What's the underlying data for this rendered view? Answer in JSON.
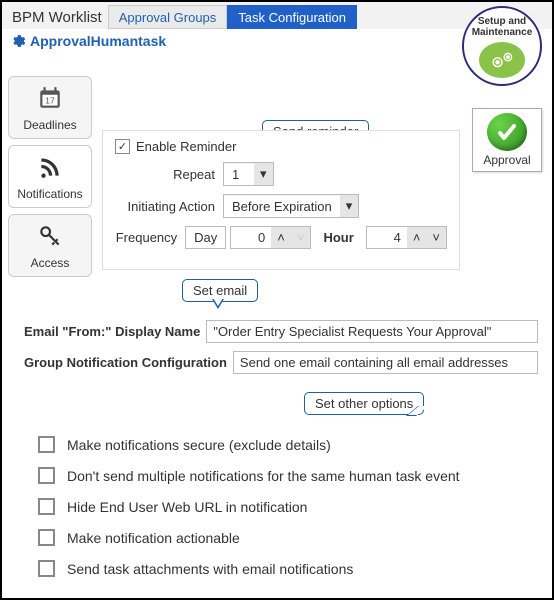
{
  "topbar": {
    "title": "BPM Worklist",
    "tabs": [
      {
        "label": "Approval Groups"
      },
      {
        "label": "Task Configuration"
      }
    ]
  },
  "task_name": "ApprovalHumantask",
  "sidebar": {
    "items": [
      {
        "label": "Deadlines"
      },
      {
        "label": "Notifications"
      },
      {
        "label": "Access"
      }
    ]
  },
  "badge_top": "Setup and Maintenance",
  "approval_box": "Approval",
  "callouts": {
    "reminder": "Send reminder",
    "email": "Set email",
    "other": "Set other options"
  },
  "reminder": {
    "enable_label": "Enable Reminder",
    "repeat_label": "Repeat",
    "repeat_value": "1",
    "initiating_label": "Initiating Action",
    "initiating_value": "Before Expiration",
    "frequency_label": "Frequency",
    "unit_value": "Day",
    "qty_value": "0",
    "hour_label": "Hour",
    "hour_value": "4"
  },
  "email": {
    "from_label": "Email \"From:\" Display Name",
    "from_value": "\"Order Entry Specialist Requests Your Approval\"",
    "group_label": "Group Notification Configuration",
    "group_value": "Send one email containing all email addresses"
  },
  "options": [
    "Make notifications secure (exclude details)",
    "Don't send multiple notifications for the same human task event",
    "Hide End User Web URL in notification",
    "Make notification actionable",
    "Send task attachments with email notifications"
  ]
}
